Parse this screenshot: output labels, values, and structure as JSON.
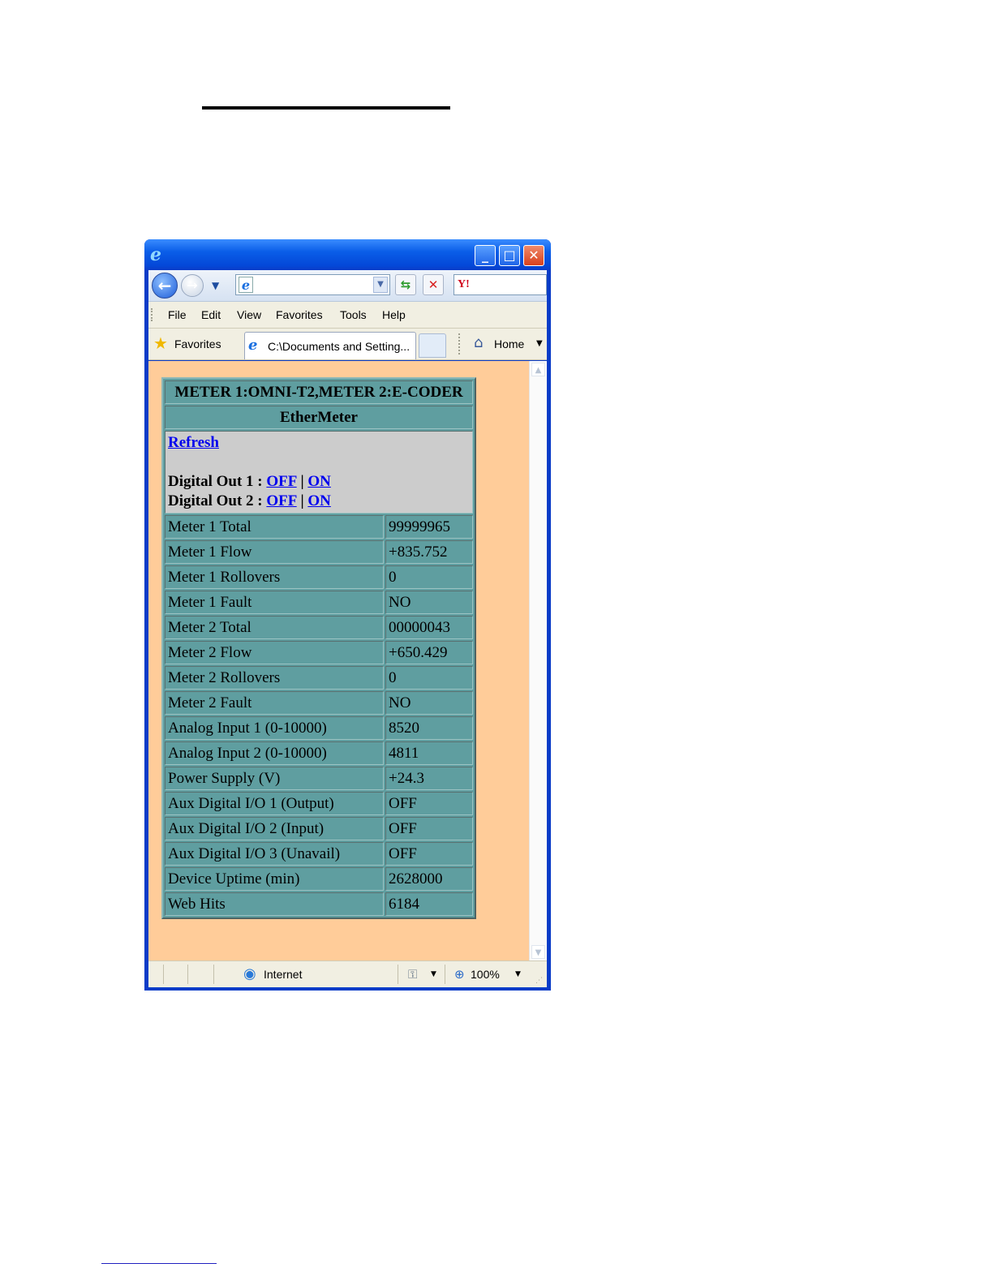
{
  "browser": {
    "menu": [
      "File",
      "Edit",
      "View",
      "Favorites",
      "Tools",
      "Help"
    ],
    "favorites_label": "Favorites",
    "tab_title": "C:\\Documents and Setting...",
    "home_label": "Home",
    "status_zone": "Internet",
    "zoom": "100%"
  },
  "page": {
    "header": "METER 1:OMNI-T2,METER 2:E-CODER",
    "subheader": "EtherMeter",
    "refresh_label": "Refresh",
    "digital_out_1_label": "Digital Out 1 :",
    "digital_out_2_label": "Digital Out 2 :",
    "off_label": "OFF",
    "on_label": "ON",
    "separator": "|",
    "rows": [
      {
        "label": "Meter 1 Total",
        "value": "99999965"
      },
      {
        "label": "Meter 1 Flow",
        "value": "+835.752"
      },
      {
        "label": "Meter 1 Rollovers",
        "value": "0"
      },
      {
        "label": "Meter 1 Fault",
        "value": "NO"
      },
      {
        "label": "Meter 2 Total",
        "value": "00000043"
      },
      {
        "label": "Meter 2 Flow",
        "value": "+650.429"
      },
      {
        "label": "Meter 2 Rollovers",
        "value": "0"
      },
      {
        "label": "Meter 2 Fault",
        "value": "NO"
      },
      {
        "label": "Analog Input 1 (0-10000)",
        "value": "8520"
      },
      {
        "label": "Analog Input 2 (0-10000)",
        "value": "4811"
      },
      {
        "label": "Power Supply (V)",
        "value": "+24.3"
      },
      {
        "label": "Aux Digital I/O 1 (Output)",
        "value": "OFF"
      },
      {
        "label": "Aux Digital I/O 2 (Input)",
        "value": "OFF"
      },
      {
        "label": "Aux Digital I/O 3 (Unavail)",
        "value": "OFF"
      },
      {
        "label": "Device Uptime (min)",
        "value": "2628000"
      },
      {
        "label": "Web Hits",
        "value": "6184"
      }
    ]
  },
  "colors": {
    "page_background": "#ffcc99",
    "table_teal": "#5f9ea0",
    "panel_gray": "#cccccc",
    "link_blue": "#0000ee",
    "titlebar_blue": "#0a5ee8"
  },
  "icons": [
    "ie-logo-icon",
    "minimize-icon",
    "maximize-icon",
    "close-icon",
    "back-arrow-icon",
    "forward-arrow-icon",
    "go-refresh-icon",
    "stop-icon",
    "yahoo-icon",
    "star-icon",
    "home-icon",
    "globe-icon",
    "protected-mode-icon",
    "zoom-icon"
  ]
}
